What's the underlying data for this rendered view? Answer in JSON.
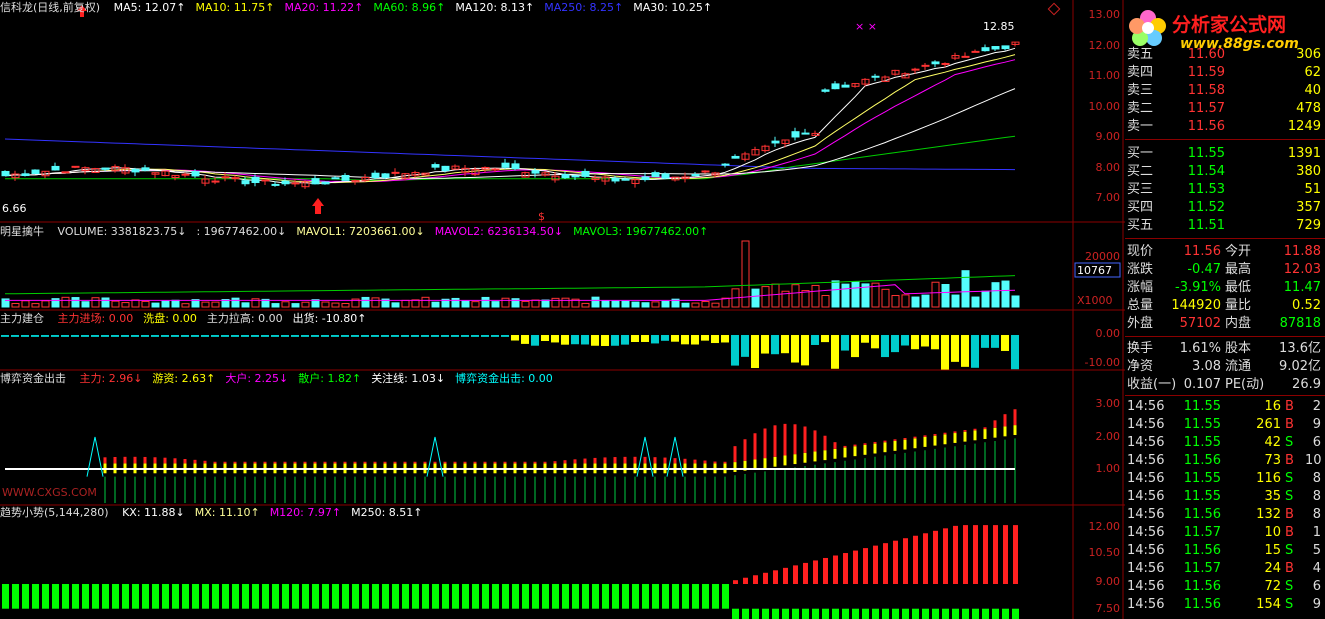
{
  "main_panel": {
    "title": "信科龙(日线,前复权)",
    "ma_items": [
      {
        "label": "MA5: 12.07",
        "color": "#ffffff",
        "arrow": "↑"
      },
      {
        "label": "MA10: 11.75",
        "color": "#ffff00",
        "arrow": "↑"
      },
      {
        "label": "MA20: 11.22",
        "color": "#ff00ff",
        "arrow": "↑"
      },
      {
        "label": "MA60: 8.96",
        "color": "#00ff00",
        "arrow": "↑"
      },
      {
        "label": "MA120: 8.13",
        "color": "#ffffff",
        "arrow": "↑"
      },
      {
        "label": "MA250: 8.25",
        "color": "#3333ff",
        "arrow": "↑"
      },
      {
        "label": "MA30: 10.25",
        "color": "#ffffff",
        "arrow": "↑"
      }
    ],
    "y_labels": [
      "13.00",
      "12.00",
      "11.00",
      "10.00",
      "9.00",
      "8.00",
      "7.00"
    ],
    "high_label": "12.85",
    "low_label": "6.66"
  },
  "volume_panel": {
    "title": "明星擒牛",
    "items": [
      {
        "label": "VOLUME: 3381823.75",
        "color": "#dddddd",
        "arrow": "↓"
      },
      {
        "label": ": 19677462.00",
        "color": "#dddddd",
        "arrow": "↓"
      },
      {
        "label": "MAVOL1: 7203661.00",
        "color": "#ffff99",
        "arrow": "↓"
      },
      {
        "label": "MAVOL2: 6236134.50",
        "color": "#ff00ff",
        "arrow": "↓"
      },
      {
        "label": "MAVOL3: 19677462.00",
        "color": "#00ff00",
        "arrow": "↑"
      }
    ],
    "y_labels": [
      "20000",
      "10000"
    ],
    "current_box": "10767",
    "multiplier": "X1000"
  },
  "capital_panel": {
    "title": "主力建仓",
    "items": [
      {
        "label": "主力进场: 0.00",
        "color": "#ff3333"
      },
      {
        "label": "洗盘: 0.00",
        "color": "#ffff00"
      },
      {
        "label": "主力拉高: 0.00",
        "color": "#dddddd"
      },
      {
        "label": "出货: -10.80",
        "color": "#ffffff",
        "arrow": "↑"
      }
    ],
    "y_labels": [
      "0.00",
      "-10.00"
    ]
  },
  "game_panel": {
    "title": "博弈资金出击",
    "items": [
      {
        "label": "主力: 2.96",
        "color": "#ff3333",
        "arrow": "↓"
      },
      {
        "label": "游资: 2.63",
        "color": "#ffff00",
        "arrow": "↑"
      },
      {
        "label": "大户: 2.25",
        "color": "#ff00ff",
        "arrow": "↓"
      },
      {
        "label": "散户: 1.82",
        "color": "#00ff00",
        "arrow": "↑"
      },
      {
        "label": "关注线: 1.03",
        "color": "#ffffff",
        "arrow": "↓"
      },
      {
        "label": "博弈资金出击: 0.00",
        "color": "#00ffff"
      }
    ],
    "y_labels": [
      "3.00",
      "2.00",
      "1.00"
    ],
    "watermark": "WWW.CXGS.COM"
  },
  "trend_panel": {
    "title": "趋势小势(5,144,280)",
    "items": [
      {
        "label": "KX: 11.88",
        "color": "#ffffff",
        "arrow": "↓"
      },
      {
        "label": "MX: 11.10",
        "color": "#ffff99",
        "arrow": "↑"
      },
      {
        "label": "M120: 7.97",
        "color": "#ff00ff",
        "arrow": "↑"
      },
      {
        "label": "M250: 8.51",
        "color": "#ffffff",
        "arrow": "↑"
      }
    ],
    "y_labels": [
      "12.00",
      "10.50",
      "9.00",
      "7.50"
    ]
  },
  "logo": {
    "title": "分析家公式网",
    "url": "www.88gs.com"
  },
  "order_book": {
    "sell": [
      {
        "label": "卖五",
        "price": "11.60",
        "qty": "306"
      },
      {
        "label": "卖四",
        "price": "11.59",
        "qty": "62"
      },
      {
        "label": "卖三",
        "price": "11.58",
        "qty": "40"
      },
      {
        "label": "卖二",
        "price": "11.57",
        "qty": "478"
      },
      {
        "label": "卖一",
        "price": "11.56",
        "qty": "1249"
      }
    ],
    "buy": [
      {
        "label": "买一",
        "price": "11.55",
        "qty": "1391"
      },
      {
        "label": "买二",
        "price": "11.54",
        "qty": "380"
      },
      {
        "label": "买三",
        "price": "11.53",
        "qty": "51"
      },
      {
        "label": "买四",
        "price": "11.52",
        "qty": "357"
      },
      {
        "label": "买五",
        "price": "11.51",
        "qty": "729"
      }
    ]
  },
  "quote": [
    {
      "l1": "现价",
      "v1": "11.56",
      "c1": "#ff3333",
      "l2": "今开",
      "v2": "11.88",
      "c2": "#ff3333"
    },
    {
      "l1": "涨跌",
      "v1": "-0.47",
      "c1": "#00ff00",
      "l2": "最高",
      "v2": "12.03",
      "c2": "#ff3333"
    },
    {
      "l1": "涨幅",
      "v1": "-3.91%",
      "c1": "#00ff00",
      "l2": "最低",
      "v2": "11.47",
      "c2": "#00ff00"
    },
    {
      "l1": "总量",
      "v1": "144920",
      "c1": "#ffff00",
      "l2": "量比",
      "v2": "0.52",
      "c2": "#ffff00"
    },
    {
      "l1": "外盘",
      "v1": "57102",
      "c1": "#ff3333",
      "l2": "内盘",
      "v2": "87818",
      "c2": "#00ff00"
    }
  ],
  "fundamentals": [
    {
      "l1": "换手",
      "v1": "1.61%",
      "l2": "股本",
      "v2": "13.6亿"
    },
    {
      "l1": "净资",
      "v1": "3.08",
      "l2": "流通",
      "v2": "9.02亿"
    },
    {
      "l1": "收益(一)",
      "v1": "0.107",
      "l2": "PE(动)",
      "v2": "26.9"
    }
  ],
  "ticks": [
    {
      "time": "14:56",
      "price": "11.55",
      "vol": "16",
      "side": "B",
      "n": "2"
    },
    {
      "time": "14:56",
      "price": "11.55",
      "vol": "261",
      "side": "B",
      "n": "9"
    },
    {
      "time": "14:56",
      "price": "11.55",
      "vol": "42",
      "side": "S",
      "n": "6"
    },
    {
      "time": "14:56",
      "price": "11.56",
      "vol": "73",
      "side": "B",
      "n": "10"
    },
    {
      "time": "14:56",
      "price": "11.55",
      "vol": "116",
      "side": "S",
      "n": "8"
    },
    {
      "time": "14:56",
      "price": "11.55",
      "vol": "35",
      "side": "S",
      "n": "8"
    },
    {
      "time": "14:56",
      "price": "11.56",
      "vol": "132",
      "side": "B",
      "n": "8"
    },
    {
      "time": "14:56",
      "price": "11.57",
      "vol": "10",
      "side": "B",
      "n": "1"
    },
    {
      "time": "14:56",
      "price": "11.56",
      "vol": "15",
      "side": "S",
      "n": "5"
    },
    {
      "time": "14:56",
      "price": "11.57",
      "vol": "24",
      "side": "B",
      "n": "4"
    },
    {
      "time": "14:56",
      "price": "11.56",
      "vol": "72",
      "side": "S",
      "n": "6"
    },
    {
      "time": "14:56",
      "price": "11.56",
      "vol": "154",
      "side": "S",
      "n": "9"
    }
  ]
}
